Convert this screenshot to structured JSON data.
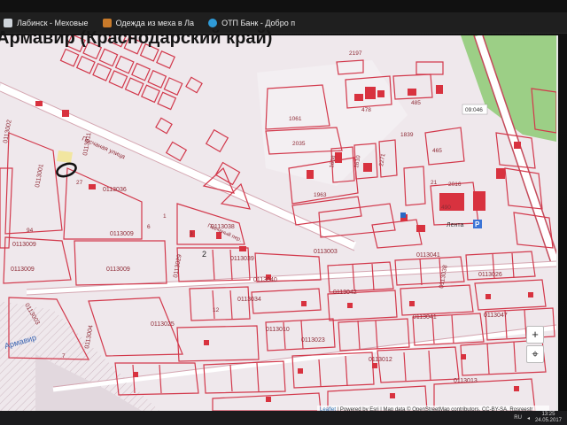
{
  "browser": {
    "bookmarks": [
      {
        "label": "Лабинск - Меховые",
        "color": "#cfd4da"
      },
      {
        "label": "Одежда из меха в Ла",
        "color": "#c87a2a"
      },
      {
        "label": "ОТП Банк - Добро п",
        "color": "#2f9bd8"
      }
    ]
  },
  "page": {
    "heading": "Армавир (Краснодарский край)"
  },
  "map": {
    "street_labels": {
      "main": "Песчаная улица",
      "secondary": "Песчаный пер."
    },
    "parcels": [
      {
        "id": "p2197",
        "text": "2197"
      },
      {
        "id": "p1061",
        "text": "1061"
      },
      {
        "id": "p478",
        "text": "478"
      },
      {
        "id": "p485",
        "text": "485"
      },
      {
        "id": "p2035",
        "text": "2035"
      },
      {
        "id": "p1963",
        "text": "1963"
      },
      {
        "id": "p1608",
        "text": "1608"
      },
      {
        "id": "p1610",
        "text": "1610"
      },
      {
        "id": "p2271",
        "text": "2271"
      },
      {
        "id": "p465",
        "text": "465"
      },
      {
        "id": "p490",
        "text": "490"
      },
      {
        "id": "p2016",
        "text": "2016"
      },
      {
        "id": "p1839",
        "text": "1839"
      },
      {
        "id": "p21",
        "text": "21"
      },
      {
        "id": "p27",
        "text": "27"
      },
      {
        "id": "p6",
        "text": "6"
      },
      {
        "id": "p1",
        "text": "1"
      },
      {
        "id": "p2",
        "text": "2"
      },
      {
        "id": "p3",
        "text": "3"
      },
      {
        "id": "p12",
        "text": "12"
      },
      {
        "id": "p7",
        "text": "7"
      },
      {
        "id": "p94",
        "text": "94"
      }
    ],
    "blocks": [
      {
        "id": "b_a",
        "text": "0113002"
      },
      {
        "id": "b_b",
        "text": "0113001"
      },
      {
        "id": "b_c",
        "text": "0113011"
      },
      {
        "id": "b_d",
        "text": "0113036"
      },
      {
        "id": "b_e",
        "text": "0113009"
      },
      {
        "id": "b_f",
        "text": "0113009"
      },
      {
        "id": "b_g",
        "text": "0113009"
      },
      {
        "id": "b_h",
        "text": "0113009"
      },
      {
        "id": "b_i",
        "text": "0113038"
      },
      {
        "id": "b_j",
        "text": "0113039"
      },
      {
        "id": "b_k",
        "text": "0113003"
      },
      {
        "id": "b_l",
        "text": "0113003"
      },
      {
        "id": "b_m",
        "text": "0113042"
      },
      {
        "id": "b_n",
        "text": "0113040"
      },
      {
        "id": "b_o",
        "text": "0113034"
      },
      {
        "id": "b_p",
        "text": "0113029"
      },
      {
        "id": "b_q",
        "text": "0113025"
      },
      {
        "id": "b_r",
        "text": "0113041"
      },
      {
        "id": "b_s",
        "text": "0113038"
      },
      {
        "id": "b_t",
        "text": "0113041"
      },
      {
        "id": "b_u",
        "text": "0113026"
      },
      {
        "id": "b_v",
        "text": "0113010"
      },
      {
        "id": "b_w",
        "text": "0113023"
      },
      {
        "id": "b_x",
        "text": "0113012"
      },
      {
        "id": "b_y",
        "text": "0113047"
      },
      {
        "id": "b_z",
        "text": "0113013"
      },
      {
        "id": "b_aa",
        "text": "0113004"
      }
    ],
    "road_ref": "09:046",
    "store_name": "Лента",
    "parking": "P",
    "district_label": "Армавир",
    "zoom_in": "+",
    "locate": "⌖"
  },
  "attribution": {
    "leaflet": "Leaflet",
    "text": " | Powered by Esri | Map data © OpenStreetMap contributors, CC-BY-SA, Rosreestr"
  },
  "taskbar": {
    "lang": "RU",
    "time": "13:25",
    "date": "24.05.2017"
  }
}
